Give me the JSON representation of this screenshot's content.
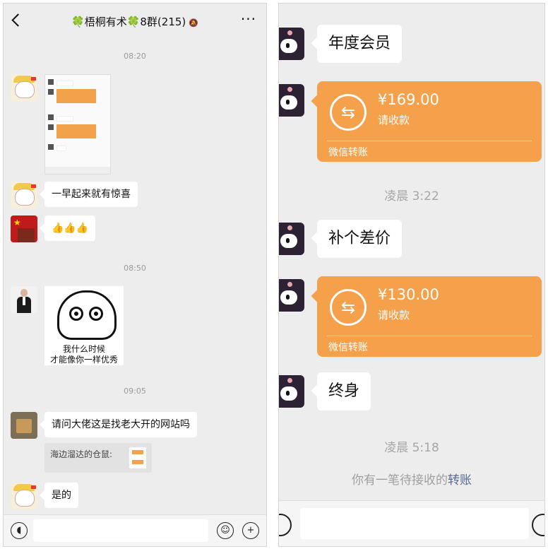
{
  "left": {
    "header": {
      "title": "🍀梧桐有术🍀8群(215)",
      "more_label": "···"
    },
    "times": [
      "08:20",
      "08:50",
      "09:05"
    ],
    "messages": {
      "surprise": "一早起来就有惊喜",
      "thumbs": "👍👍👍",
      "question": "请问大佬这是找老大开的网站吗",
      "quote": "海边溜达的仓鼠:",
      "reply": "是的"
    },
    "sticker_text": [
      "我什么时候",
      "才能像你一样优秀"
    ]
  },
  "right": {
    "messages": {
      "annual": "年度会员",
      "diff": "补个差价",
      "lifetime": "终身"
    },
    "transfers": [
      {
        "amount": "¥169.00",
        "status": "请收款",
        "footer": "微信转账"
      },
      {
        "amount": "¥130.00",
        "status": "请收款",
        "footer": "微信转账"
      }
    ],
    "times": [
      "凌晨 3:22",
      "凌晨 5:18"
    ],
    "pending": {
      "prefix": "你有一笔待接收的",
      "link": "转账"
    }
  },
  "colors": {
    "accent_orange": "#f5a04a",
    "link_blue": "#576b95",
    "chat_bg": "#ededed"
  },
  "icons": [
    "back-icon",
    "mute-bell-icon",
    "more-icon",
    "voice-icon",
    "emoji-icon",
    "plus-icon",
    "transfer-icon"
  ]
}
